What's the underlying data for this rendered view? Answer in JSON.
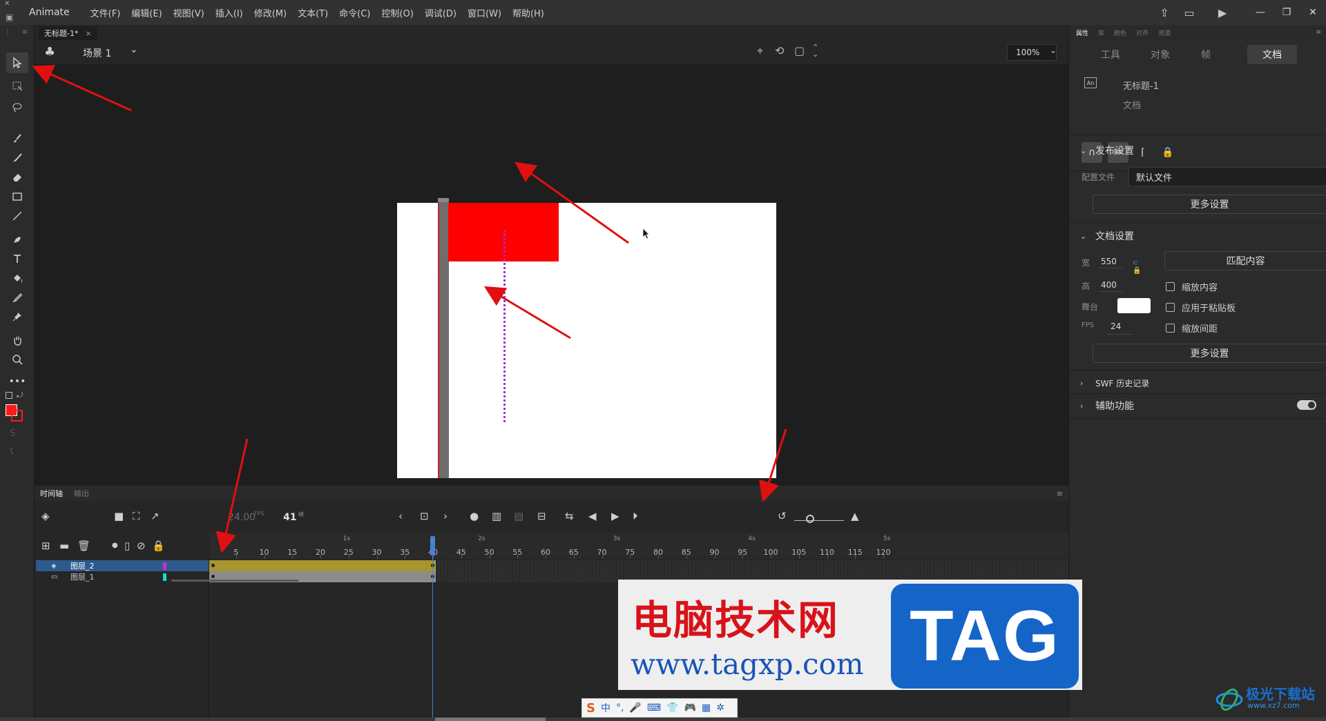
{
  "app": {
    "name": "Animate",
    "menu": [
      "文件(F)",
      "编辑(E)",
      "视图(V)",
      "插入(I)",
      "修改(M)",
      "文本(T)",
      "命令(C)",
      "控制(O)",
      "调试(D)",
      "窗口(W)",
      "帮助(H)"
    ]
  },
  "document": {
    "tab_title": "无标题-1*",
    "close_glyph": "×"
  },
  "scene": {
    "label": "场景 1",
    "zoom": "100%"
  },
  "timeline": {
    "tabs": [
      "时间轴",
      "输出"
    ],
    "fps": "24.00",
    "fps_unit": "FPS",
    "current_frame": "41",
    "frame_unit": "帧",
    "seconds": [
      "1s",
      "2s",
      "3s",
      "4s",
      "5s"
    ],
    "frame_numbers": [
      "5",
      "10",
      "15",
      "20",
      "25",
      "30",
      "35",
      "40",
      "45",
      "50",
      "55",
      "60",
      "65",
      "70",
      "75",
      "80",
      "85",
      "90",
      "95",
      "100",
      "105",
      "110",
      "115",
      "120"
    ],
    "layers": [
      {
        "name": "图层_2",
        "selected": true,
        "color": "#c832c8",
        "tween_color": "#a8952f"
      },
      {
        "name": "图层_1",
        "selected": false,
        "color": "#18d8d8",
        "tween_color": "#8c8c8c"
      }
    ],
    "tween_end_frame": 41
  },
  "properties": {
    "top_tabs": [
      "属性",
      "库",
      "颜色",
      "对齐",
      "资源"
    ],
    "sub_tabs": [
      "工具",
      "对象",
      "帧",
      "文档"
    ],
    "active_sub_tab": "文档",
    "doc_icon_text": "An",
    "doc_name": "无标题-1",
    "doc_type": "文档",
    "publish": {
      "header": "发布设置",
      "profile_label": "配置文件",
      "profile_value": "默认文件",
      "more_button": "更多设置"
    },
    "doc_settings": {
      "header": "文档设置",
      "width_label": "宽",
      "width_value": "550",
      "height_label": "高",
      "height_value": "400",
      "match_button": "匹配内容",
      "stage_label": "舞台",
      "stage_color": "#ffffff",
      "fps_label": "FPS",
      "fps_value": "24",
      "checkboxes": [
        "缩放内容",
        "应用于粘贴板",
        "缩放间距"
      ],
      "more_button": "更多设置"
    },
    "swf_history": "SWF 历史记录",
    "accessibility": "辅助功能"
  },
  "watermark": {
    "cn": "电脑技术网",
    "url": "www.tagxp.com",
    "tag": "TAG"
  },
  "ime_bar": {
    "items": [
      "中",
      "°,",
      "🎤",
      "⌨",
      "👕",
      "🎮",
      "▦",
      "✲"
    ]
  },
  "corner_logo": {
    "title": "极光下载站",
    "url": "www.xz7.com"
  },
  "colors": {
    "accent": "#4a7fd4",
    "flag": "#ff0000",
    "motion_path": "#a030c8",
    "arrow": "#e01010"
  }
}
